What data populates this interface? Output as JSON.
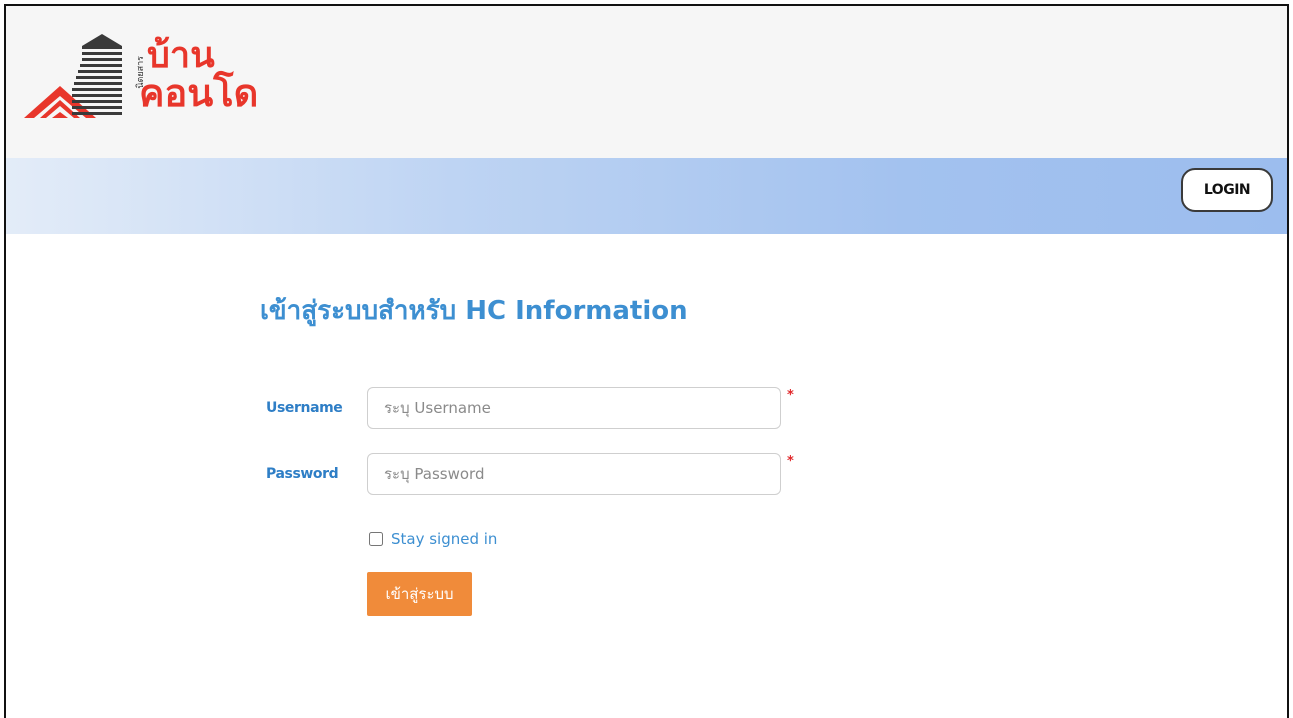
{
  "header": {
    "logo": {
      "line1": "บ้าน",
      "line2": "คอนโด",
      "side_text": "นิตยสาร"
    }
  },
  "navbar": {
    "login_label": "LOGIN"
  },
  "main": {
    "title": "เข้าสู่ระบบสำหรับ HC Information",
    "username": {
      "label": "Username",
      "placeholder": "ระบุ Username",
      "value": "",
      "required_mark": "*"
    },
    "password": {
      "label": "Password",
      "placeholder": "ระบุ Password",
      "value": "",
      "required_mark": "*"
    },
    "stay_signed_in": {
      "label": "Stay signed in",
      "checked": false
    },
    "submit_label": "เข้าสู่ระบบ"
  },
  "colors": {
    "brand_red": "#e8362b",
    "title_blue": "#3d8fd1",
    "label_blue": "#2e7ec6",
    "submit_orange": "#f08b3a",
    "navbar_blue": "#a3c2ef"
  }
}
